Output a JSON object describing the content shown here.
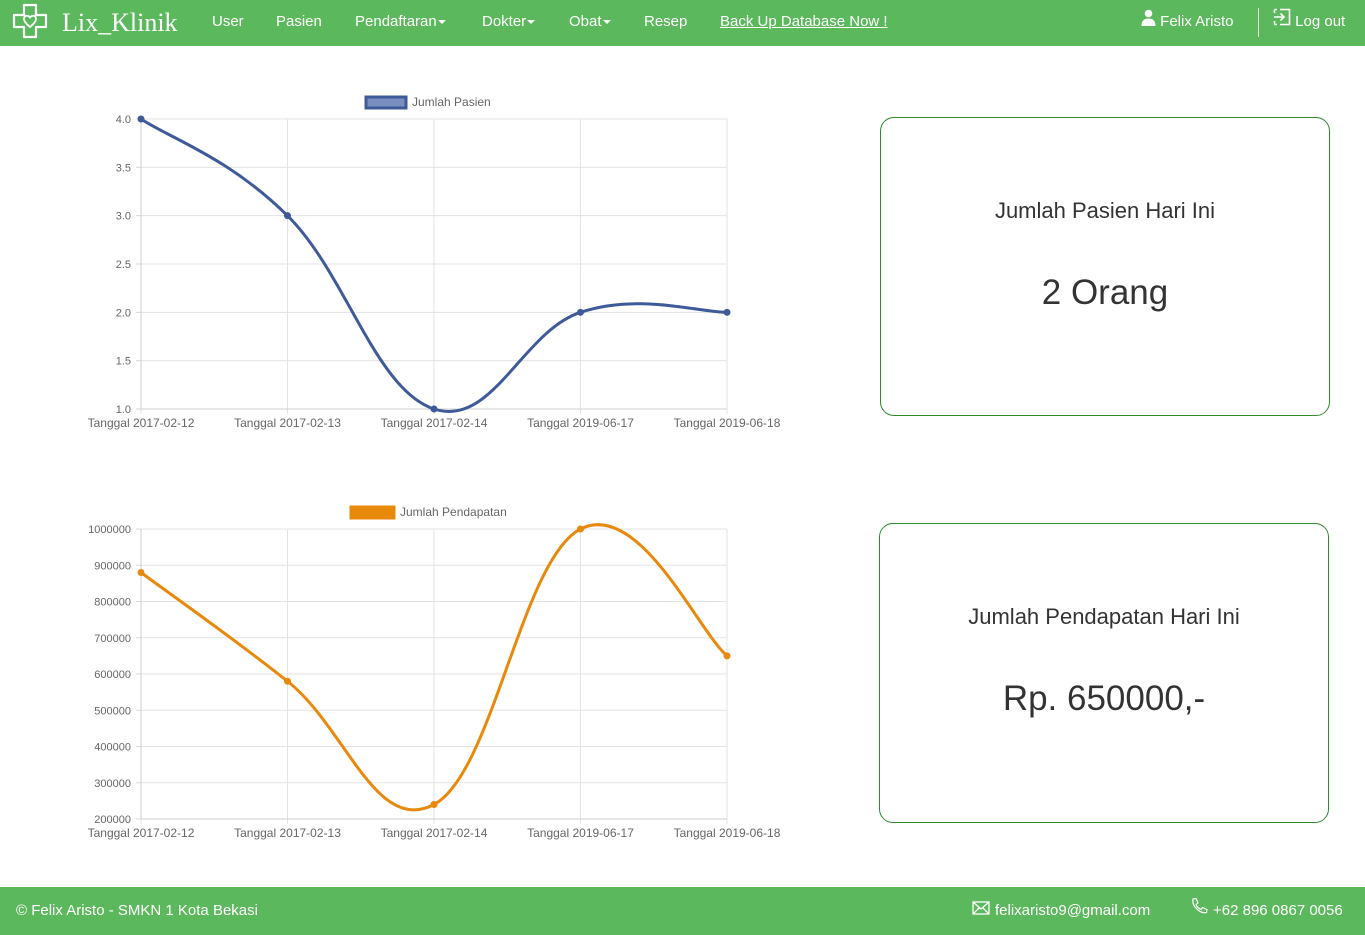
{
  "nav": {
    "brand": "Lix_Klinik",
    "items": [
      {
        "label": "User",
        "dropdown": false
      },
      {
        "label": "Pasien",
        "dropdown": false
      },
      {
        "label": "Pendaftaran",
        "dropdown": true
      },
      {
        "label": "Dokter",
        "dropdown": true
      },
      {
        "label": "Obat",
        "dropdown": true
      },
      {
        "label": "Resep",
        "dropdown": false
      }
    ],
    "backup": "Back Up Database Now !",
    "user": "Felix Aristo",
    "logout": "Log out",
    "icons": {
      "brand": "medical-cross-heart-icon",
      "user": "user-icon",
      "logout": "logout-icon"
    }
  },
  "chart_data": [
    {
      "type": "line",
      "legend": "Jumlah Pasien",
      "color": "#3e5a98",
      "categories": [
        "Tanggal 2017-02-12",
        "Tanggal 2017-02-13",
        "Tanggal 2017-02-14",
        "Tanggal 2019-06-17",
        "Tanggal 2019-06-18"
      ],
      "series": [
        {
          "name": "Jumlah Pasien",
          "values": [
            4,
            3,
            1,
            2,
            2
          ]
        }
      ],
      "ylim": [
        1.0,
        4.0
      ],
      "yticks": [
        "4.0",
        "3.5",
        "3.0",
        "2.5",
        "2.0",
        "1.5",
        "1.0"
      ],
      "grid": true,
      "legend_position": "top"
    },
    {
      "type": "line",
      "legend": "Jumlah Pendapatan",
      "color": "#e8890c",
      "categories": [
        "Tanggal 2017-02-12",
        "Tanggal 2017-02-13",
        "Tanggal 2017-02-14",
        "Tanggal 2019-06-17",
        "Tanggal 2019-06-18"
      ],
      "series": [
        {
          "name": "Jumlah Pendapatan",
          "values": [
            880000,
            580000,
            240000,
            1000000,
            650000
          ]
        }
      ],
      "ylim": [
        200000,
        1000000
      ],
      "yticks": [
        "1000000",
        "900000",
        "800000",
        "700000",
        "600000",
        "500000",
        "400000",
        "300000",
        "200000"
      ],
      "grid": true,
      "legend_position": "top"
    }
  ],
  "cards": [
    {
      "title": "Jumlah Pasien Hari Ini",
      "value": "2 Orang"
    },
    {
      "title": "Jumlah Pendapatan Hari Ini",
      "value": "Rp. 650000,-"
    }
  ],
  "footer": {
    "copyright": "© Felix Aristo - SMKN 1 Kota Bekasi",
    "email": "felixaristo9@gmail.com",
    "phone": "+62 896 0867 0056",
    "icons": {
      "email": "envelope-icon",
      "phone": "phone-icon"
    }
  }
}
